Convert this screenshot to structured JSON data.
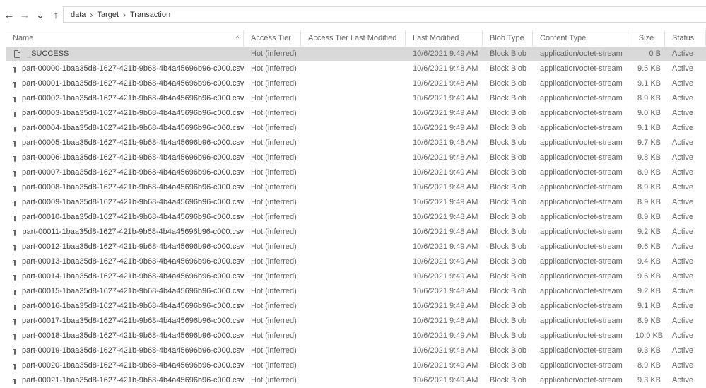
{
  "nav": {
    "back": "←",
    "forward": "→",
    "recent": "⌄",
    "up": "↑"
  },
  "breadcrumb": [
    "data",
    "Target",
    "Transaction"
  ],
  "columns": [
    "Name",
    "Access Tier",
    "Access Tier Last Modified",
    "Last Modified",
    "Blob Type",
    "Content Type",
    "Size",
    "Status"
  ],
  "rows": [
    {
      "name": "_SUCCESS",
      "tier": "Hot (inferred)",
      "tier_mod": "",
      "modified": "10/6/2021 9:49 AM",
      "blob_type": "Block Blob",
      "content_type": "application/octet-stream",
      "size": "0 B",
      "status": "Active"
    },
    {
      "name": "part-00000-1baa35d8-1627-421b-9b68-4b4a45696b96-c000.csv",
      "tier": "Hot (inferred)",
      "tier_mod": "",
      "modified": "10/6/2021 9:48 AM",
      "blob_type": "Block Blob",
      "content_type": "application/octet-stream",
      "size": "9.5 KB",
      "status": "Active"
    },
    {
      "name": "part-00001-1baa35d8-1627-421b-9b68-4b4a45696b96-c000.csv",
      "tier": "Hot (inferred)",
      "tier_mod": "",
      "modified": "10/6/2021 9:48 AM",
      "blob_type": "Block Blob",
      "content_type": "application/octet-stream",
      "size": "9.1 KB",
      "status": "Active"
    },
    {
      "name": "part-00002-1baa35d8-1627-421b-9b68-4b4a45696b96-c000.csv",
      "tier": "Hot (inferred)",
      "tier_mod": "",
      "modified": "10/6/2021 9:49 AM",
      "blob_type": "Block Blob",
      "content_type": "application/octet-stream",
      "size": "8.9 KB",
      "status": "Active"
    },
    {
      "name": "part-00003-1baa35d8-1627-421b-9b68-4b4a45696b96-c000.csv",
      "tier": "Hot (inferred)",
      "tier_mod": "",
      "modified": "10/6/2021 9:49 AM",
      "blob_type": "Block Blob",
      "content_type": "application/octet-stream",
      "size": "9.0 KB",
      "status": "Active"
    },
    {
      "name": "part-00004-1baa35d8-1627-421b-9b68-4b4a45696b96-c000.csv",
      "tier": "Hot (inferred)",
      "tier_mod": "",
      "modified": "10/6/2021 9:49 AM",
      "blob_type": "Block Blob",
      "content_type": "application/octet-stream",
      "size": "9.1 KB",
      "status": "Active"
    },
    {
      "name": "part-00005-1baa35d8-1627-421b-9b68-4b4a45696b96-c000.csv",
      "tier": "Hot (inferred)",
      "tier_mod": "",
      "modified": "10/6/2021 9:48 AM",
      "blob_type": "Block Blob",
      "content_type": "application/octet-stream",
      "size": "9.7 KB",
      "status": "Active"
    },
    {
      "name": "part-00006-1baa35d8-1627-421b-9b68-4b4a45696b96-c000.csv",
      "tier": "Hot (inferred)",
      "tier_mod": "",
      "modified": "10/6/2021 9:48 AM",
      "blob_type": "Block Blob",
      "content_type": "application/octet-stream",
      "size": "9.8 KB",
      "status": "Active"
    },
    {
      "name": "part-00007-1baa35d8-1627-421b-9b68-4b4a45696b96-c000.csv",
      "tier": "Hot (inferred)",
      "tier_mod": "",
      "modified": "10/6/2021 9:49 AM",
      "blob_type": "Block Blob",
      "content_type": "application/octet-stream",
      "size": "8.9 KB",
      "status": "Active"
    },
    {
      "name": "part-00008-1baa35d8-1627-421b-9b68-4b4a45696b96-c000.csv",
      "tier": "Hot (inferred)",
      "tier_mod": "",
      "modified": "10/6/2021 9:48 AM",
      "blob_type": "Block Blob",
      "content_type": "application/octet-stream",
      "size": "8.9 KB",
      "status": "Active"
    },
    {
      "name": "part-00009-1baa35d8-1627-421b-9b68-4b4a45696b96-c000.csv",
      "tier": "Hot (inferred)",
      "tier_mod": "",
      "modified": "10/6/2021 9:49 AM",
      "blob_type": "Block Blob",
      "content_type": "application/octet-stream",
      "size": "8.9 KB",
      "status": "Active"
    },
    {
      "name": "part-00010-1baa35d8-1627-421b-9b68-4b4a45696b96-c000.csv",
      "tier": "Hot (inferred)",
      "tier_mod": "",
      "modified": "10/6/2021 9:48 AM",
      "blob_type": "Block Blob",
      "content_type": "application/octet-stream",
      "size": "8.9 KB",
      "status": "Active"
    },
    {
      "name": "part-00011-1baa35d8-1627-421b-9b68-4b4a45696b96-c000.csv",
      "tier": "Hot (inferred)",
      "tier_mod": "",
      "modified": "10/6/2021 9:48 AM",
      "blob_type": "Block Blob",
      "content_type": "application/octet-stream",
      "size": "9.2 KB",
      "status": "Active"
    },
    {
      "name": "part-00012-1baa35d8-1627-421b-9b68-4b4a45696b96-c000.csv",
      "tier": "Hot (inferred)",
      "tier_mod": "",
      "modified": "10/6/2021 9:49 AM",
      "blob_type": "Block Blob",
      "content_type": "application/octet-stream",
      "size": "9.6 KB",
      "status": "Active"
    },
    {
      "name": "part-00013-1baa35d8-1627-421b-9b68-4b4a45696b96-c000.csv",
      "tier": "Hot (inferred)",
      "tier_mod": "",
      "modified": "10/6/2021 9:49 AM",
      "blob_type": "Block Blob",
      "content_type": "application/octet-stream",
      "size": "9.4 KB",
      "status": "Active"
    },
    {
      "name": "part-00014-1baa35d8-1627-421b-9b68-4b4a45696b96-c000.csv",
      "tier": "Hot (inferred)",
      "tier_mod": "",
      "modified": "10/6/2021 9:49 AM",
      "blob_type": "Block Blob",
      "content_type": "application/octet-stream",
      "size": "9.6 KB",
      "status": "Active"
    },
    {
      "name": "part-00015-1baa35d8-1627-421b-9b68-4b4a45696b96-c000.csv",
      "tier": "Hot (inferred)",
      "tier_mod": "",
      "modified": "10/6/2021 9:48 AM",
      "blob_type": "Block Blob",
      "content_type": "application/octet-stream",
      "size": "9.2 KB",
      "status": "Active"
    },
    {
      "name": "part-00016-1baa35d8-1627-421b-9b68-4b4a45696b96-c000.csv",
      "tier": "Hot (inferred)",
      "tier_mod": "",
      "modified": "10/6/2021 9:49 AM",
      "blob_type": "Block Blob",
      "content_type": "application/octet-stream",
      "size": "9.1 KB",
      "status": "Active"
    },
    {
      "name": "part-00017-1baa35d8-1627-421b-9b68-4b4a45696b96-c000.csv",
      "tier": "Hot (inferred)",
      "tier_mod": "",
      "modified": "10/6/2021 9:48 AM",
      "blob_type": "Block Blob",
      "content_type": "application/octet-stream",
      "size": "8.9 KB",
      "status": "Active"
    },
    {
      "name": "part-00018-1baa35d8-1627-421b-9b68-4b4a45696b96-c000.csv",
      "tier": "Hot (inferred)",
      "tier_mod": "",
      "modified": "10/6/2021 9:49 AM",
      "blob_type": "Block Blob",
      "content_type": "application/octet-stream",
      "size": "10.0 KB",
      "status": "Active"
    },
    {
      "name": "part-00019-1baa35d8-1627-421b-9b68-4b4a45696b96-c000.csv",
      "tier": "Hot (inferred)",
      "tier_mod": "",
      "modified": "10/6/2021 9:48 AM",
      "blob_type": "Block Blob",
      "content_type": "application/octet-stream",
      "size": "9.3 KB",
      "status": "Active"
    },
    {
      "name": "part-00020-1baa35d8-1627-421b-9b68-4b4a45696b96-c000.csv",
      "tier": "Hot (inferred)",
      "tier_mod": "",
      "modified": "10/6/2021 9:49 AM",
      "blob_type": "Block Blob",
      "content_type": "application/octet-stream",
      "size": "8.9 KB",
      "status": "Active"
    },
    {
      "name": "part-00021-1baa35d8-1627-421b-9b68-4b4a45696b96-c000.csv",
      "tier": "Hot (inferred)",
      "tier_mod": "",
      "modified": "10/6/2021 9:49 AM",
      "blob_type": "Block Blob",
      "content_type": "application/octet-stream",
      "size": "9.3 KB",
      "status": "Active"
    }
  ]
}
